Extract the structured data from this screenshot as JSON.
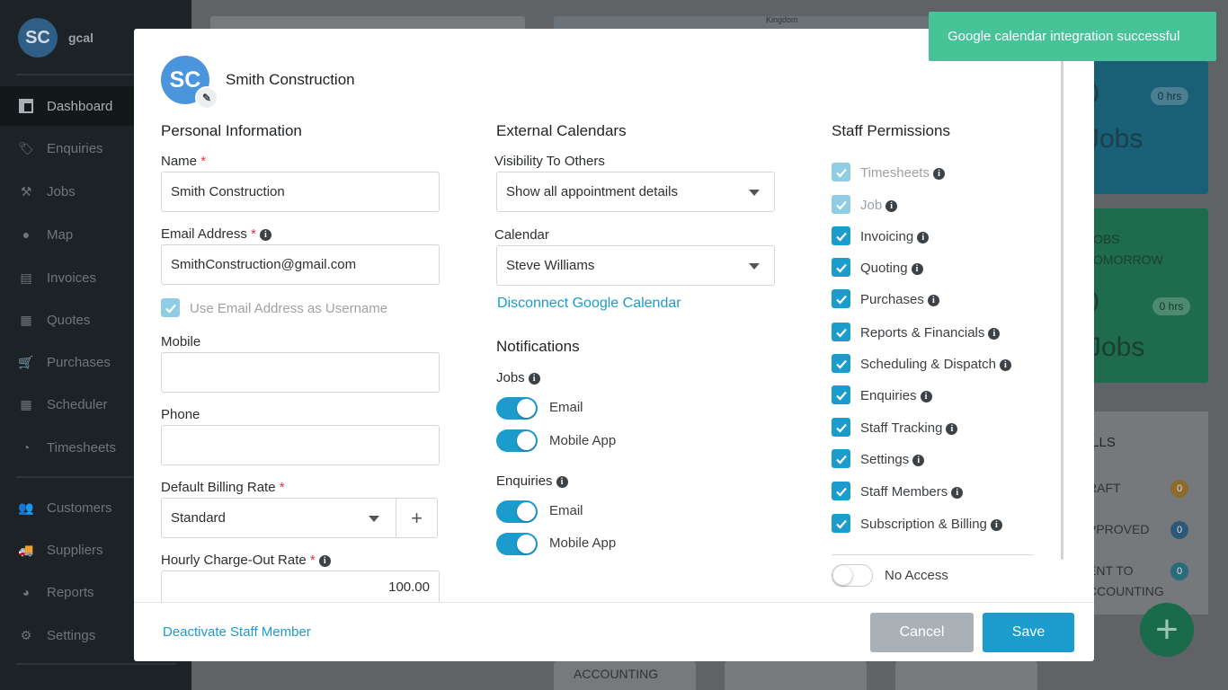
{
  "sidebar": {
    "user": {
      "initials": "SC",
      "name": "gcal"
    },
    "items": [
      {
        "label": "Dashboard",
        "icon": "dashboard-icon"
      },
      {
        "label": "Enquiries",
        "icon": "tag-icon"
      },
      {
        "label": "Jobs",
        "icon": "hammer-icon"
      },
      {
        "label": "Map",
        "icon": "map-pin-icon"
      },
      {
        "label": "Invoices",
        "icon": "invoice-icon"
      },
      {
        "label": "Quotes",
        "icon": "calculator-icon"
      },
      {
        "label": "Purchases",
        "icon": "cart-icon"
      },
      {
        "label": "Scheduler",
        "icon": "calendar-icon"
      },
      {
        "label": "Timesheets",
        "icon": "clock-icon"
      },
      {
        "label": "Customers",
        "icon": "users-icon"
      },
      {
        "label": "Suppliers",
        "icon": "truck-icon"
      },
      {
        "label": "Reports",
        "icon": "pie-chart-icon"
      },
      {
        "label": "Settings",
        "icon": "gear-icon"
      }
    ]
  },
  "background": {
    "map_label": "Kingdom",
    "card1": {
      "big": "0",
      "pill": "0 hrs",
      "word": "Jobs"
    },
    "card2": {
      "line1": "OBS",
      "line2": "OMORROW",
      "big": "0",
      "pill": "0 hrs",
      "word": "Jobs"
    },
    "bills": {
      "title": "ILLS",
      "rows": [
        {
          "label": "RAFT",
          "count": "0",
          "color": "#c98a2a"
        },
        {
          "label": "PPROVED",
          "count": "0",
          "color": "#2f6f9c"
        },
        {
          "label": "ENT TO",
          "label2": "CCOUNTING",
          "count": "0",
          "color": "#1e8ca6"
        }
      ]
    },
    "bottom_label": "ACCOUNTING",
    "fab": "+"
  },
  "toast": {
    "message": "Google calendar integration successful"
  },
  "modal": {
    "avatar_initials": "SC",
    "title": "Smith Construction",
    "personal": {
      "title": "Personal Information",
      "name_label": "Name",
      "name_value": "Smith Construction",
      "email_label": "Email Address",
      "email_value": "SmithConstruction@gmail.com",
      "use_email_label": "Use Email Address as Username",
      "mobile_label": "Mobile",
      "mobile_value": "",
      "phone_label": "Phone",
      "phone_value": "",
      "billing_label": "Default Billing Rate",
      "billing_value": "Standard",
      "hourly_label": "Hourly Charge-Out Rate",
      "hourly_value": "100.00",
      "required_mark": "*",
      "plus": "+"
    },
    "calendars": {
      "title": "External Calendars",
      "visibility_label": "Visibility To Others",
      "visibility_value": "Show all appointment details",
      "calendar_label": "Calendar",
      "calendar_value": "Steve Williams",
      "disconnect": "Disconnect Google Calendar"
    },
    "notifications": {
      "title": "Notifications",
      "jobs_label": "Jobs",
      "enquiries_label": "Enquiries",
      "email": "Email",
      "mobile_app": "Mobile App"
    },
    "permissions": {
      "title": "Staff Permissions",
      "items": [
        {
          "label": "Timesheets",
          "disabled": true
        },
        {
          "label": "Job",
          "disabled": true
        },
        {
          "label": "Invoicing",
          "disabled": false
        },
        {
          "label": "Quoting",
          "disabled": false
        },
        {
          "label": "Purchases",
          "disabled": false
        },
        {
          "label": "Reports & Financials",
          "disabled": false
        },
        {
          "label": "Scheduling & Dispatch",
          "disabled": false
        },
        {
          "label": "Enquiries",
          "disabled": false
        },
        {
          "label": "Staff Tracking",
          "disabled": false
        },
        {
          "label": "Settings",
          "disabled": false
        },
        {
          "label": "Staff Members",
          "disabled": false
        },
        {
          "label": "Subscription & Billing",
          "disabled": false
        }
      ],
      "no_access": "No Access"
    },
    "footer": {
      "deactivate": "Deactivate Staff Member",
      "cancel": "Cancel",
      "save": "Save"
    }
  }
}
